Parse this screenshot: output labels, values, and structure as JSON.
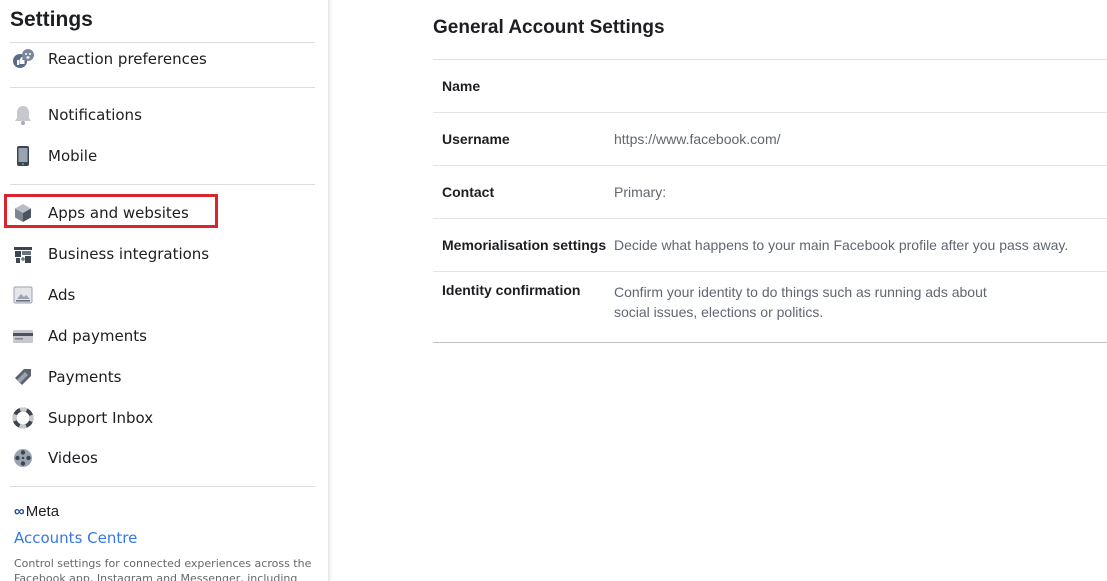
{
  "sidebar": {
    "title": "Settings",
    "items": [
      {
        "label": "Reaction preferences",
        "icon": "reaction-icon"
      },
      {
        "label": "Notifications",
        "icon": "bell-icon"
      },
      {
        "label": "Mobile",
        "icon": "mobile-icon"
      },
      {
        "label": "Apps and websites",
        "icon": "cube-icon"
      },
      {
        "label": "Business integrations",
        "icon": "puzzle-icon"
      },
      {
        "label": "Ads",
        "icon": "ads-icon"
      },
      {
        "label": "Ad payments",
        "icon": "card-icon"
      },
      {
        "label": "Payments",
        "icon": "tag-icon"
      },
      {
        "label": "Support Inbox",
        "icon": "lifebuoy-icon"
      },
      {
        "label": "Videos",
        "icon": "film-reel-icon"
      }
    ],
    "highlighted_item": "Apps and websites",
    "highlight_color": "#d9262e",
    "meta_label": "Meta",
    "accounts_centre": "Accounts Centre",
    "accounts_desc": "Control settings for connected experiences across the Facebook app, Instagram and Messenger, including"
  },
  "main": {
    "title": "General Account Settings",
    "rows": [
      {
        "label": "Name",
        "value": ""
      },
      {
        "label": "Username",
        "value": "https://www.facebook.com/"
      },
      {
        "label": "Contact",
        "value": "Primary:"
      },
      {
        "label": "Memorialisation settings",
        "value": "Decide what happens to your main Facebook profile after you pass away."
      },
      {
        "label": "Identity confirmation",
        "value": "Confirm your identity to do things such as running ads about social issues, elections or politics."
      }
    ]
  }
}
